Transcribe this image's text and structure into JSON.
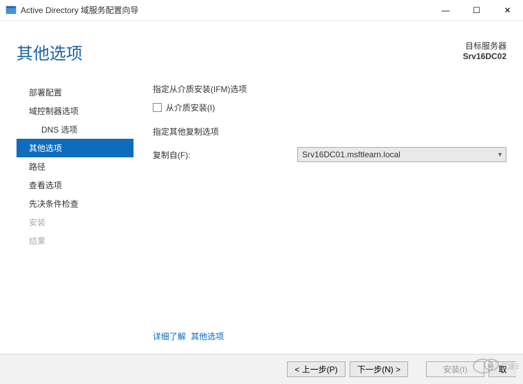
{
  "window": {
    "title": "Active Directory 域服务配置向导",
    "minimize": "—",
    "maximize": "☐",
    "close": "✕"
  },
  "header": {
    "heading": "其他选项",
    "target_label": "目标服务器",
    "target_value": "Srv16DC02"
  },
  "sidebar": {
    "items": [
      {
        "label": "部署配置"
      },
      {
        "label": "域控制器选项"
      },
      {
        "label": "DNS 选项"
      },
      {
        "label": "其他选项"
      },
      {
        "label": "路径"
      },
      {
        "label": "查看选项"
      },
      {
        "label": "先决条件检查"
      }
    ],
    "disabled": [
      {
        "label": "安装"
      },
      {
        "label": "结果"
      }
    ]
  },
  "content": {
    "ifm_section_label": "指定从介质安装(IFM)选项",
    "ifm_checkbox_label": "从介质安装(I)",
    "replicate_section_label": "指定其他复制选项",
    "replicate_from_label": "复制自(F):",
    "replicate_from_value": "Srv16DC01.msftlearn.local"
  },
  "more_link": {
    "prefix": "详细了解",
    "topic": "其他选项"
  },
  "footer": {
    "prev": "< 上一步(P)",
    "next": "下一步(N) >",
    "install": "安装(I)",
    "cancel": "取"
  },
  "watermark_text": "亿速云"
}
